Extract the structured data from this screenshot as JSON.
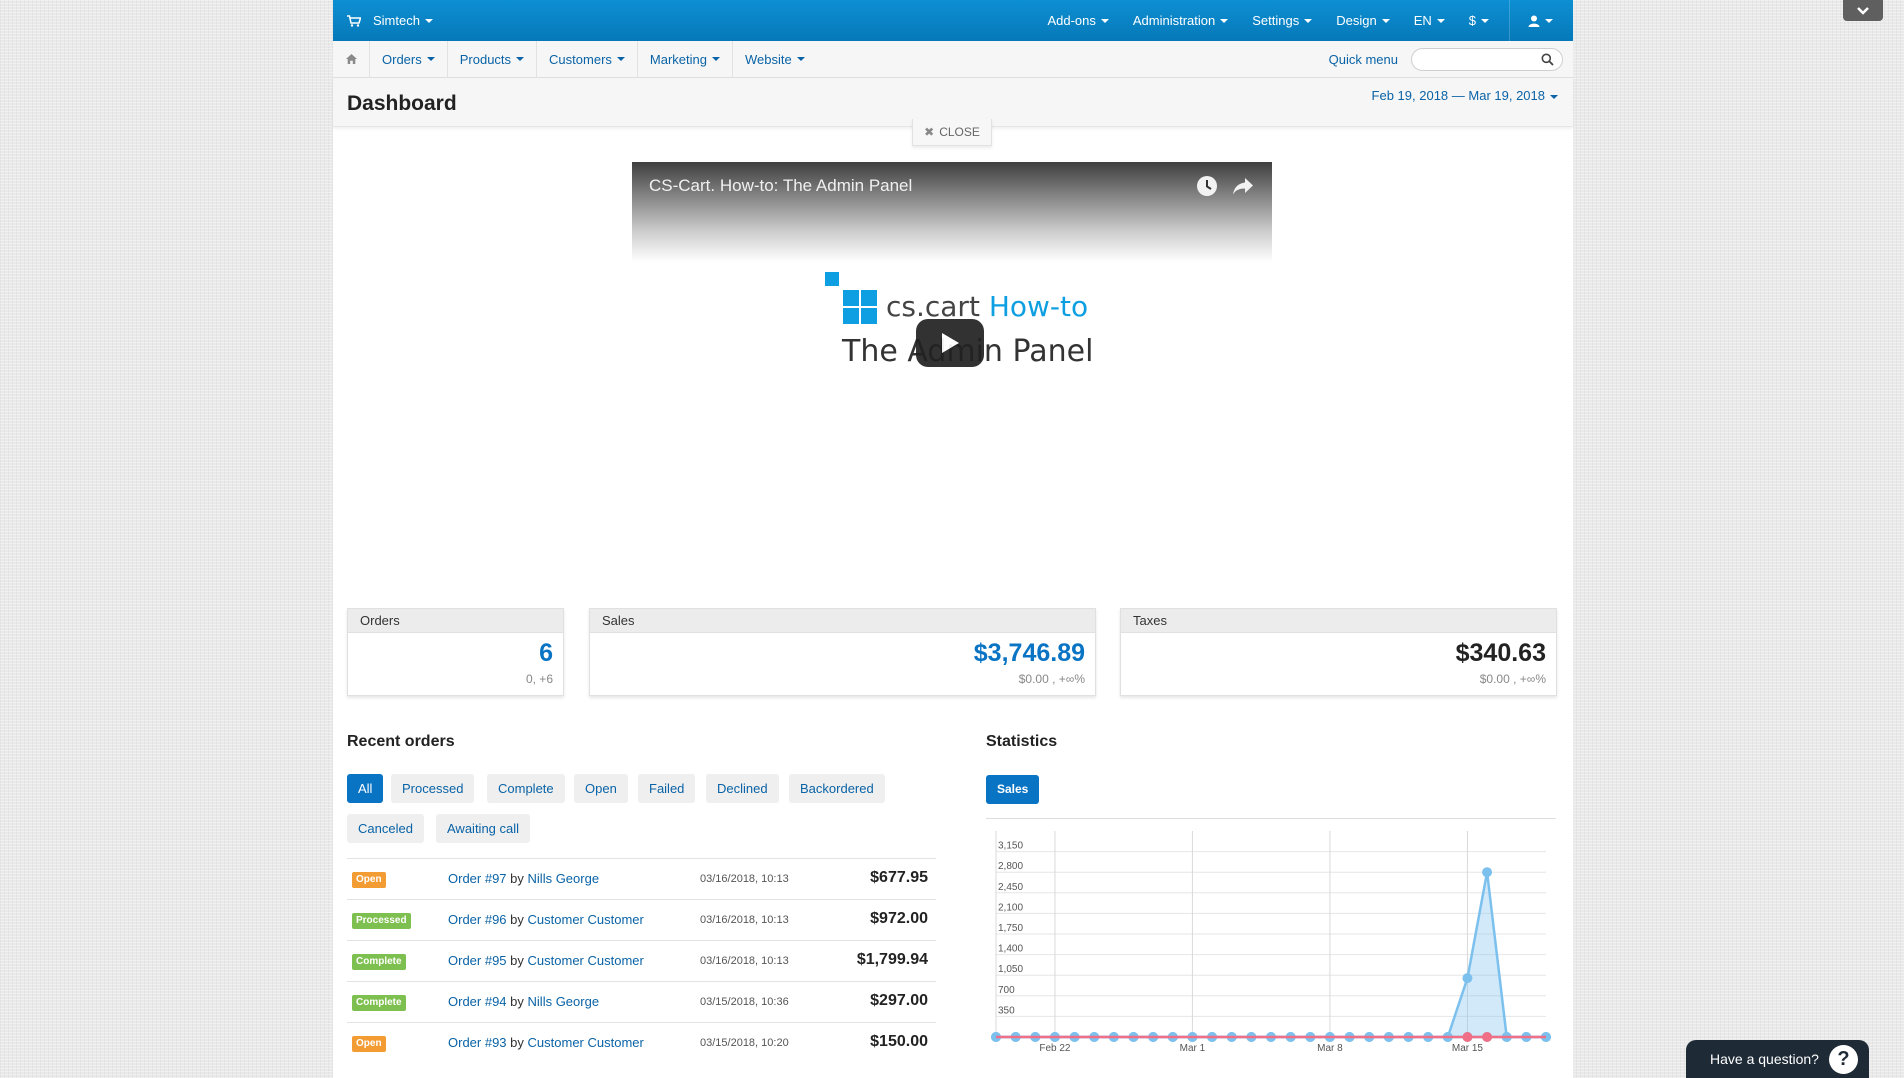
{
  "topbar": {
    "store": "Simtech",
    "menu": [
      "Add-ons",
      "Administration",
      "Settings",
      "Design",
      "EN",
      "$"
    ]
  },
  "subnav": {
    "items": [
      "Orders",
      "Products",
      "Customers",
      "Marketing",
      "Website"
    ],
    "quick_menu": "Quick menu"
  },
  "page": {
    "title": "Dashboard",
    "date_range": "Feb 19, 2018 — Mar 19, 2018",
    "close_label": "CLOSE"
  },
  "video": {
    "title": "CS-Cart. How-to: The Admin Panel",
    "brand": "cs.cart",
    "brand_accent": "How-to",
    "subtitle": "The Admin Panel"
  },
  "stats": {
    "orders": {
      "label": "Orders",
      "value": "6",
      "sub": "0, +6"
    },
    "sales": {
      "label": "Sales",
      "value": "$3,746.89",
      "sub": "$0.00 , +∞%"
    },
    "taxes": {
      "label": "Taxes",
      "value": "$340.63",
      "sub": "$0.00 , +∞%"
    }
  },
  "recent_orders": {
    "title": "Recent orders",
    "filters": [
      "All",
      "Processed",
      "Complete",
      "Open",
      "Failed",
      "Declined",
      "Backordered",
      "Canceled",
      "Awaiting call"
    ],
    "rows": [
      {
        "status": "Open",
        "order": "Order #97",
        "by": "by",
        "customer": "Nills George",
        "date": "03/16/2018, 10:13",
        "amount": "$677.95"
      },
      {
        "status": "Processed",
        "order": "Order #96",
        "by": "by",
        "customer": "Customer Customer",
        "date": "03/16/2018, 10:13",
        "amount": "$972.00"
      },
      {
        "status": "Complete",
        "order": "Order #95",
        "by": "by",
        "customer": "Customer Customer",
        "date": "03/16/2018, 10:13",
        "amount": "$1,799.94"
      },
      {
        "status": "Complete",
        "order": "Order #94",
        "by": "by",
        "customer": "Nills George",
        "date": "03/15/2018, 10:36",
        "amount": "$297.00"
      },
      {
        "status": "Open",
        "order": "Order #93",
        "by": "by",
        "customer": "Customer Customer",
        "date": "03/15/2018, 10:20",
        "amount": "$150.00"
      }
    ]
  },
  "statistics": {
    "title": "Statistics",
    "tab": "Sales"
  },
  "chart_data": {
    "type": "area",
    "ylim": [
      0,
      3500
    ],
    "yticks": [
      350,
      700,
      1050,
      1400,
      1750,
      2100,
      2450,
      2800,
      3150
    ],
    "xtick_labels": [
      {
        "label": "Feb 22",
        "index": 3
      },
      {
        "label": "Mar 1",
        "index": 10
      },
      {
        "label": "Mar 8",
        "index": 17
      },
      {
        "label": "Mar 15",
        "index": 24
      }
    ],
    "x": [
      "Feb 19",
      "Feb 20",
      "Feb 21",
      "Feb 22",
      "Feb 23",
      "Feb 24",
      "Feb 25",
      "Feb 26",
      "Feb 27",
      "Feb 28",
      "Mar 1",
      "Mar 2",
      "Mar 3",
      "Mar 4",
      "Mar 5",
      "Mar 6",
      "Mar 7",
      "Mar 8",
      "Mar 9",
      "Mar 10",
      "Mar 11",
      "Mar 12",
      "Mar 13",
      "Mar 14",
      "Mar 15",
      "Mar 16",
      "Mar 17",
      "Mar 18",
      "Mar 19"
    ],
    "series": [
      {
        "color": "#7cc0ee",
        "values": [
          0,
          0,
          0,
          0,
          0,
          0,
          0,
          0,
          0,
          0,
          0,
          0,
          0,
          0,
          0,
          0,
          0,
          0,
          0,
          0,
          0,
          0,
          0,
          0,
          0,
          0,
          0,
          0,
          0
        ]
      },
      {
        "color": "#7cc0ee",
        "values": [
          0,
          0,
          0,
          0,
          0,
          0,
          0,
          0,
          0,
          0,
          0,
          0,
          0,
          0,
          0,
          0,
          0,
          0,
          0,
          0,
          0,
          0,
          0,
          0,
          1000,
          2800,
          0,
          0,
          0
        ]
      },
      {
        "color": "#f06f86",
        "values": [
          0,
          0,
          0,
          0,
          0,
          0,
          0,
          0,
          0,
          0,
          0,
          0,
          0,
          0,
          0,
          0,
          0,
          0,
          0,
          0,
          0,
          0,
          0,
          0,
          0,
          0,
          0,
          0,
          0
        ]
      }
    ],
    "grid": true
  },
  "help": {
    "label": "Have a question?",
    "icon": "?"
  }
}
